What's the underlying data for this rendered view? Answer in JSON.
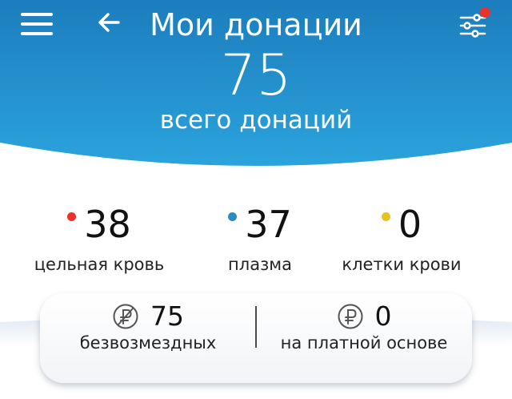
{
  "header": {
    "title": "Мои донации",
    "total": "75",
    "total_label": "всего донаций"
  },
  "stats": [
    {
      "value": "38",
      "label": "цельная кровь",
      "color": "#e8332a"
    },
    {
      "value": "37",
      "label": "плазма",
      "color": "#2a8cc6"
    },
    {
      "value": "0",
      "label": "клетки крови",
      "color": "#e8c21a"
    }
  ],
  "summary": {
    "free": {
      "value": "75",
      "label": "безвозмездных",
      "icon": "no-ruble-icon"
    },
    "paid": {
      "value": "0",
      "label": "на платной основе",
      "icon": "ruble-icon"
    }
  },
  "colors": {
    "header_top": "#1e80bf",
    "header_bottom": "#2a9fd9",
    "filter_badge": "#e8332a"
  },
  "icons": {
    "menu": "menu-icon",
    "back": "arrow-left-icon",
    "filter": "filter-sliders-icon"
  }
}
